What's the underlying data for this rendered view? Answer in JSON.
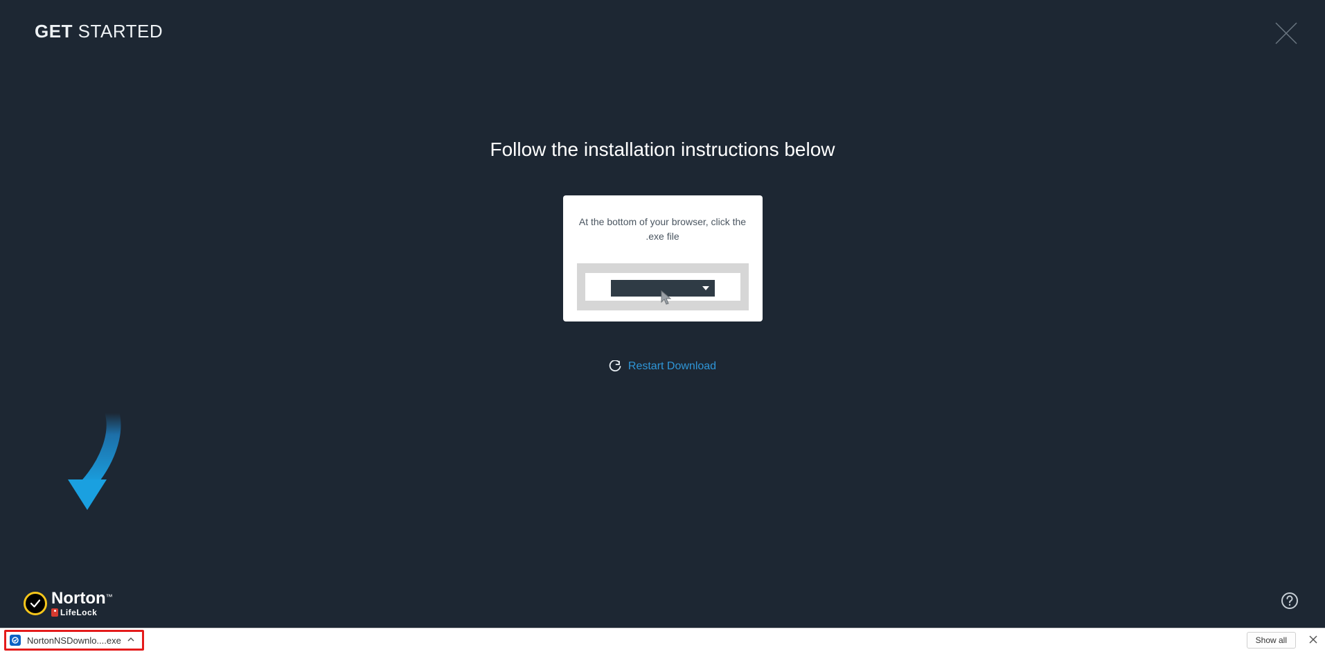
{
  "header": {
    "title_bold": "GET",
    "title_light": " STARTED"
  },
  "main": {
    "heading": "Follow the installation instructions below",
    "instruction_text": "At the bottom of your browser, click the .exe file",
    "restart_label": "Restart Download"
  },
  "logo": {
    "brand": "Norton",
    "subbrand": "LifeLock",
    "tm": "™"
  },
  "download_bar": {
    "file_name": "NortonNSDownlo....exe",
    "show_all_label": "Show all"
  },
  "colors": {
    "bg": "#1d2733",
    "accent_blue": "#1a9fe0",
    "link_blue": "#2f96d8",
    "norton_yellow": "#f6c61b",
    "highlight_red": "#e41b1b"
  }
}
